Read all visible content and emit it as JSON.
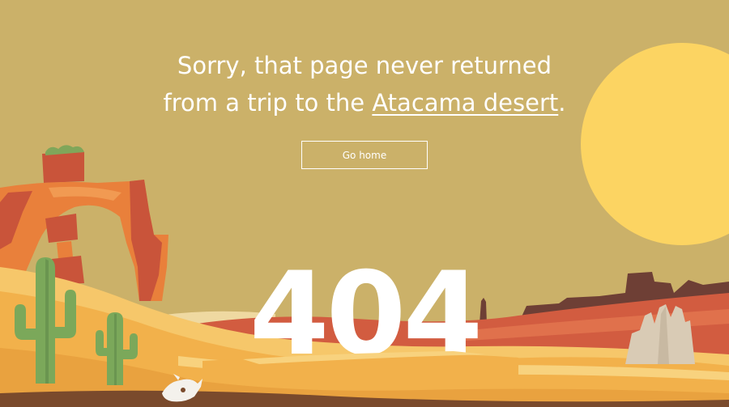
{
  "message": {
    "line1": "Sorry, that page never returned",
    "line2_prefix": "from a trip to the ",
    "link_text": "Atacama desert",
    "line2_suffix": "."
  },
  "button": {
    "label": "Go home"
  },
  "error_code": "404",
  "colors": {
    "sky": "#CBB169",
    "sun": "#FCD462",
    "sand": "#F2B14B",
    "rock": "#E9803B",
    "far_rock": "#D25C40",
    "cactus": "#7BA85A",
    "text": "#FFFFFF"
  },
  "icons": {
    "sun": "sun-icon",
    "cactus": "cactus-icon",
    "skull": "cow-skull-icon"
  }
}
